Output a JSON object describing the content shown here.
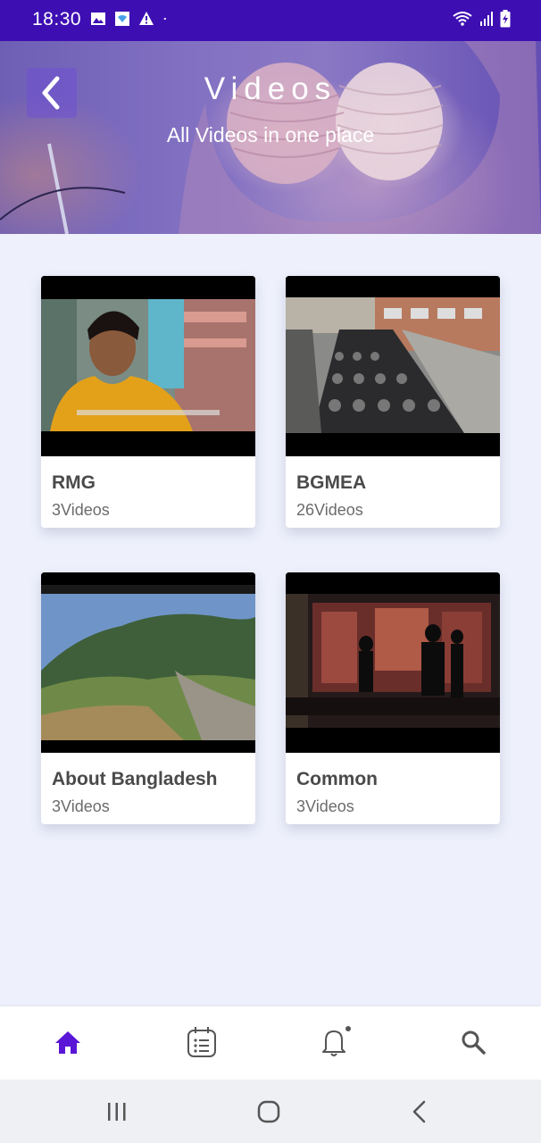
{
  "status_bar": {
    "time": "18:30",
    "left_icons": [
      "gallery-icon",
      "wifi-square-icon",
      "warning-icon",
      "dot-icon"
    ],
    "right_icons": [
      "wifi-icon",
      "signal-icon",
      "battery-charging-icon"
    ]
  },
  "header": {
    "title": "Videos",
    "subtitle": "All Videos in one place",
    "back_icon": "chevron-left-icon",
    "accent": "#3d0fb3"
  },
  "categories": [
    {
      "title": "RMG",
      "count": "3Videos"
    },
    {
      "title": "BGMEA",
      "count": "26Videos"
    },
    {
      "title": "About Bangladesh",
      "count": "3Videos"
    },
    {
      "title": "Common",
      "count": "3Videos"
    }
  ],
  "bottom_nav": {
    "items": [
      "home-icon",
      "calendar-list-icon",
      "bell-icon",
      "search-icon"
    ],
    "active": "home-icon",
    "active_color": "#5a16d6",
    "inactive_color": "#555555"
  },
  "system_nav": [
    "recent-apps-icon",
    "home-circle-icon",
    "back-icon"
  ]
}
